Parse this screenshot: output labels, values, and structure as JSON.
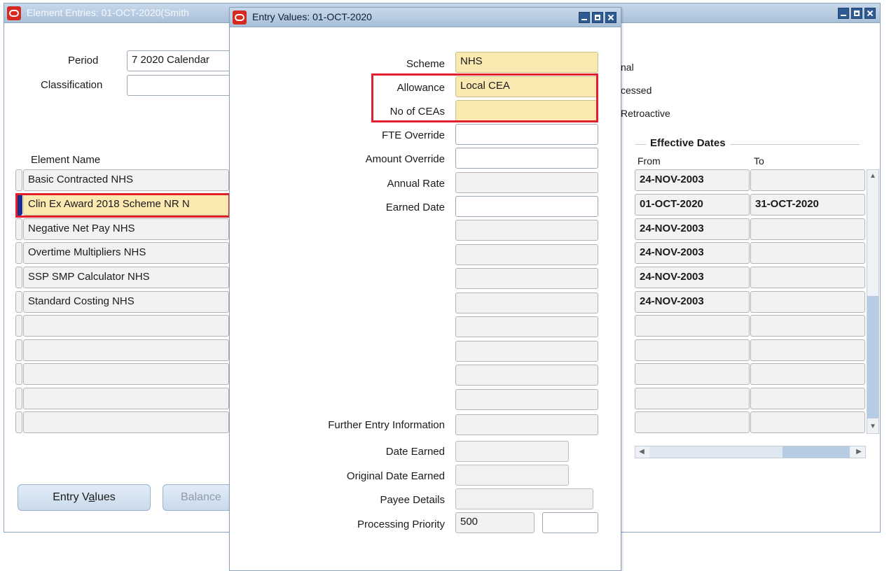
{
  "main_window": {
    "title": "Element Entries: 01-OCT-2020(Smith",
    "period_label": "Period",
    "period_value": "7 2020 Calendar",
    "classification_label": "Classification",
    "classification_value": "",
    "frag_nal": "nal",
    "frag_processed": "cessed",
    "frag_retroactive": "Retroactive",
    "element_name_header": "Element Name",
    "effective_dates_header": "Effective Dates",
    "from_header": "From",
    "to_header": "To",
    "rows": [
      {
        "name": "Basic Contracted NHS",
        "from": "24-NOV-2003",
        "to": ""
      },
      {
        "name": "Clin Ex Award 2018 Scheme NR N",
        "from": "01-OCT-2020",
        "to": "31-OCT-2020"
      },
      {
        "name": "Negative Net Pay NHS",
        "from": "24-NOV-2003",
        "to": ""
      },
      {
        "name": "Overtime Multipliers NHS",
        "from": "24-NOV-2003",
        "to": ""
      },
      {
        "name": "SSP SMP Calculator NHS",
        "from": "24-NOV-2003",
        "to": ""
      },
      {
        "name": "Standard Costing NHS",
        "from": "24-NOV-2003",
        "to": ""
      },
      {
        "name": "",
        "from": "",
        "to": ""
      },
      {
        "name": "",
        "from": "",
        "to": ""
      },
      {
        "name": "",
        "from": "",
        "to": ""
      },
      {
        "name": "",
        "from": "",
        "to": ""
      },
      {
        "name": "",
        "from": "",
        "to": ""
      }
    ],
    "entry_values_button_pre": "Entry V",
    "entry_values_button_u": "a",
    "entry_values_button_post": "lues",
    "balance_button": "Balance"
  },
  "entry_window": {
    "title": "Entry Values: 01-OCT-2020",
    "scheme_label": "Scheme",
    "scheme_value": "NHS",
    "allowance_label": "Allowance",
    "allowance_value": "Local CEA",
    "no_of_ceas_label": "No of CEAs",
    "no_of_ceas_value": "",
    "fte_override_label": "FTE Override",
    "amount_override_label": "Amount Override",
    "annual_rate_label": "Annual Rate",
    "earned_date_label": "Earned Date",
    "further_info_label": "Further Entry Information",
    "date_earned_label": "Date Earned",
    "original_date_earned_label": "Original Date Earned",
    "payee_details_label": "Payee Details",
    "processing_priority_label": "Processing Priority",
    "processing_priority_value": "500"
  },
  "colors": {
    "highlight_red": "#e0202a",
    "required_field": "#fbe9b2",
    "titlebar": "#b7cce2",
    "selected_row_marker": "#1b2f8c"
  }
}
